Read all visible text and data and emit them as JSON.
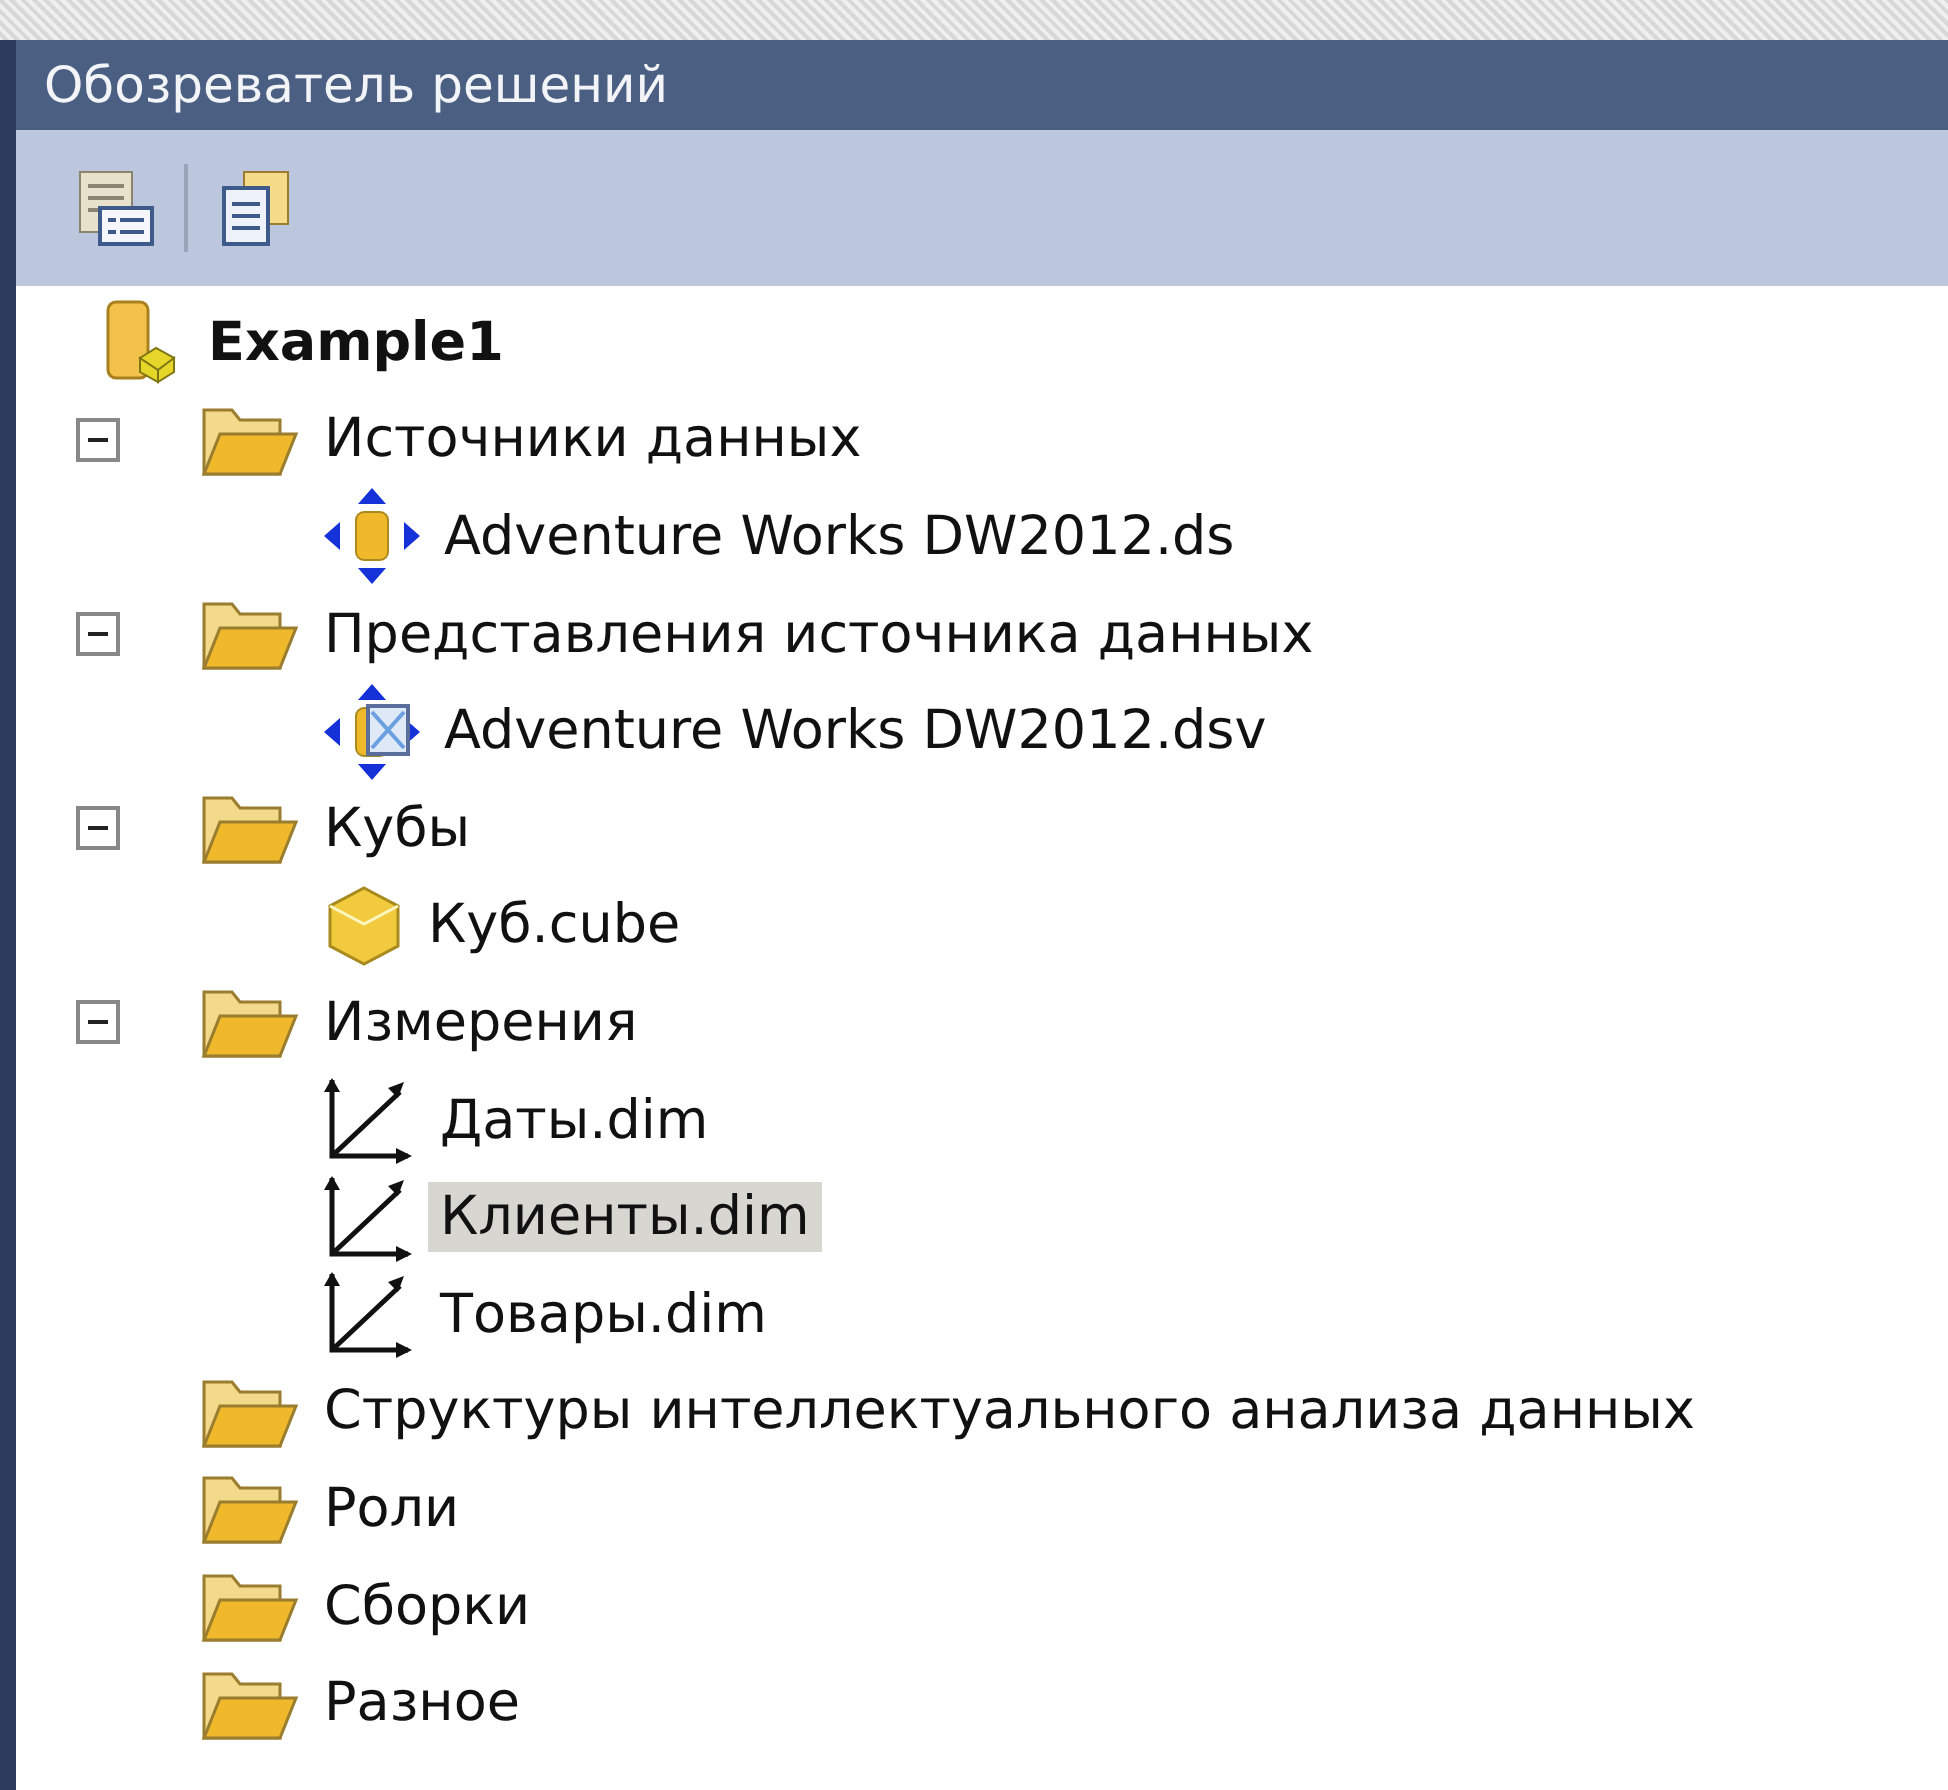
{
  "window": {
    "title": "Обозреватель решений"
  },
  "toolbar": {
    "buttons": [
      {
        "kind": "properties"
      },
      {
        "kind": "show-all"
      }
    ]
  },
  "tree": [
    {
      "label": "Example1",
      "kind": "project",
      "selected": false,
      "children": [
        {
          "label": "Источники данных",
          "kind": "folder",
          "expanded": true,
          "selected": false,
          "children": [
            {
              "label": "Adventure Works DW2012.ds",
              "kind": "datasource",
              "selected": false
            }
          ]
        },
        {
          "label": "Представления источника данных",
          "kind": "folder",
          "expanded": true,
          "selected": false,
          "children": [
            {
              "label": "Adventure Works DW2012.dsv",
              "kind": "dsv",
              "selected": false
            }
          ]
        },
        {
          "label": "Кубы",
          "kind": "folder",
          "expanded": true,
          "selected": false,
          "children": [
            {
              "label": "Куб.cube",
              "kind": "cube",
              "selected": false
            }
          ]
        },
        {
          "label": "Измерения",
          "kind": "folder",
          "expanded": true,
          "selected": false,
          "children": [
            {
              "label": "Даты.dim",
              "kind": "dimension",
              "selected": false
            },
            {
              "label": "Клиенты.dim",
              "kind": "dimension",
              "selected": true
            },
            {
              "label": "Товары.dim",
              "kind": "dimension",
              "selected": false
            }
          ]
        },
        {
          "label": "Структуры интеллектуального анализа данных",
          "kind": "folder",
          "selected": false
        },
        {
          "label": "Роли",
          "kind": "folder",
          "selected": false
        },
        {
          "label": "Сборки",
          "kind": "folder",
          "selected": false
        },
        {
          "label": "Разное",
          "kind": "folder",
          "selected": false
        }
      ]
    }
  ]
}
